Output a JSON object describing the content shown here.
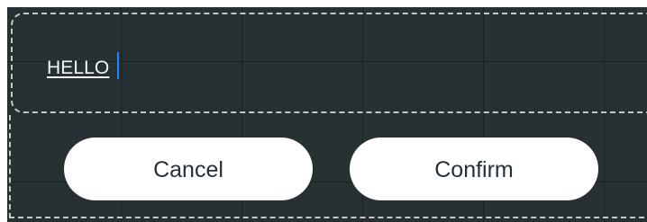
{
  "input": {
    "value": "HELLO"
  },
  "buttons": {
    "cancel_label": "Cancel",
    "confirm_label": "Confirm"
  },
  "colors": {
    "background": "#273033",
    "button_background": "#ffffff",
    "button_text": "#26323a",
    "input_text": "#f4f4f4",
    "caret": "#1e88ff",
    "dashed_outline": "#c7c7c7"
  }
}
